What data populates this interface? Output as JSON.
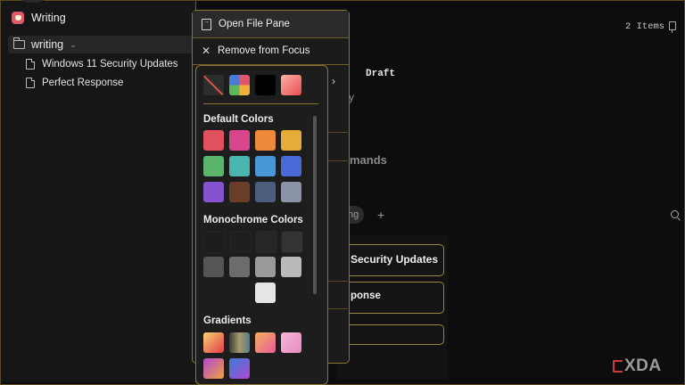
{
  "sidebar": {
    "workspace": "Writing",
    "folder": "writing",
    "pages": [
      "Windows 11 Security Updates",
      "Perfect Response"
    ]
  },
  "main": {
    "items_count": "2 Items",
    "status_label": "Draft",
    "frag_y": "y",
    "frag_mands": "mands",
    "frag_pill": "ng",
    "plus": "+",
    "cards": [
      "Security Updates",
      "ponse",
      ""
    ]
  },
  "context_menu": {
    "open_file_pane": "Open File Pane",
    "remove_from_focus": "Remove from Focus"
  },
  "color_panel": {
    "top_swatches": [
      {
        "name": "no-color",
        "value": ""
      },
      {
        "name": "multicolor",
        "value": ""
      },
      {
        "name": "black",
        "value": "#000000"
      },
      {
        "name": "red-gradient",
        "value": "linear-gradient(135deg,#ffb0a8,#e64e4e)"
      }
    ],
    "default_title": "Default Colors",
    "default_colors": [
      "#e0505f",
      "#d9468d",
      "#ec8a3a",
      "#e7ab38",
      "#5bb66c",
      "#4bb6ad",
      "#4a97d8",
      "#4a68d6",
      "#8553d0",
      "#6a3d2b",
      "#4c5d7d",
      "#8a93a8"
    ],
    "mono_title": "Monochrome Colors",
    "mono_colors": [
      "#1d1d1d",
      "#1f1f1f",
      "#262626",
      "#333333",
      "#555555",
      "#6c6c6c",
      "#9a9a9a",
      "#bababa",
      "#e5e5e5"
    ],
    "gradients_title": "Gradients",
    "gradients": [
      "linear-gradient(135deg,#f6d36f,#e23b4a)",
      "linear-gradient(90deg,#3b3b3b,#a89a6a,#5a7b8a)",
      "linear-gradient(135deg,#f3b05a,#e75c9a)",
      "linear-gradient(135deg,#f5b8d8,#e88ac0)",
      "linear-gradient(135deg,#b04ad0,#f0a040)",
      "linear-gradient(135deg,#3a7bd8,#b04ad0)"
    ]
  },
  "watermark": "XDA"
}
